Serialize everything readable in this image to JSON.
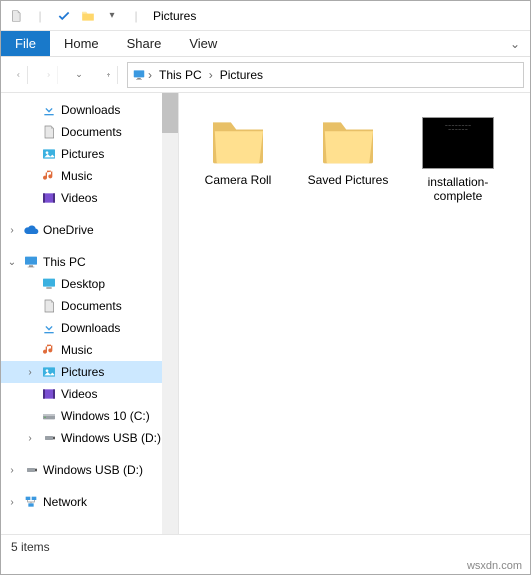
{
  "window": {
    "title": "Pictures"
  },
  "ribbon": {
    "file": "File",
    "tabs": [
      "Home",
      "Share",
      "View"
    ]
  },
  "breadcrumb": {
    "crumbs": [
      "This PC",
      "Pictures"
    ]
  },
  "quickaccess": {
    "items": [
      {
        "label": "Downloads",
        "icon": "downloads",
        "pinned": true
      },
      {
        "label": "Documents",
        "icon": "documents",
        "pinned": true
      },
      {
        "label": "Pictures",
        "icon": "pictures",
        "pinned": true
      },
      {
        "label": "Music",
        "icon": "music",
        "pinned": false
      },
      {
        "label": "Videos",
        "icon": "videos",
        "pinned": false
      }
    ]
  },
  "onedrive": {
    "label": "OneDrive"
  },
  "thispc": {
    "label": "This PC",
    "children": [
      {
        "label": "Desktop",
        "icon": "desktop"
      },
      {
        "label": "Documents",
        "icon": "documents"
      },
      {
        "label": "Downloads",
        "icon": "downloads"
      },
      {
        "label": "Music",
        "icon": "music"
      },
      {
        "label": "Pictures",
        "icon": "pictures",
        "selected": true
      },
      {
        "label": "Videos",
        "icon": "videos"
      },
      {
        "label": "Windows 10 (C:)",
        "icon": "drive"
      },
      {
        "label": "Windows USB (D:)",
        "icon": "usb"
      }
    ]
  },
  "extra": [
    {
      "label": "Windows USB (D:)",
      "icon": "usb"
    },
    {
      "label": "Network",
      "icon": "network"
    }
  ],
  "files": [
    {
      "name": "Camera Roll",
      "type": "folder"
    },
    {
      "name": "Saved Pictures",
      "type": "folder"
    },
    {
      "name": "installation-complete",
      "type": "image"
    }
  ],
  "status": {
    "text": "5 items"
  },
  "watermark": "wsxdn.com"
}
